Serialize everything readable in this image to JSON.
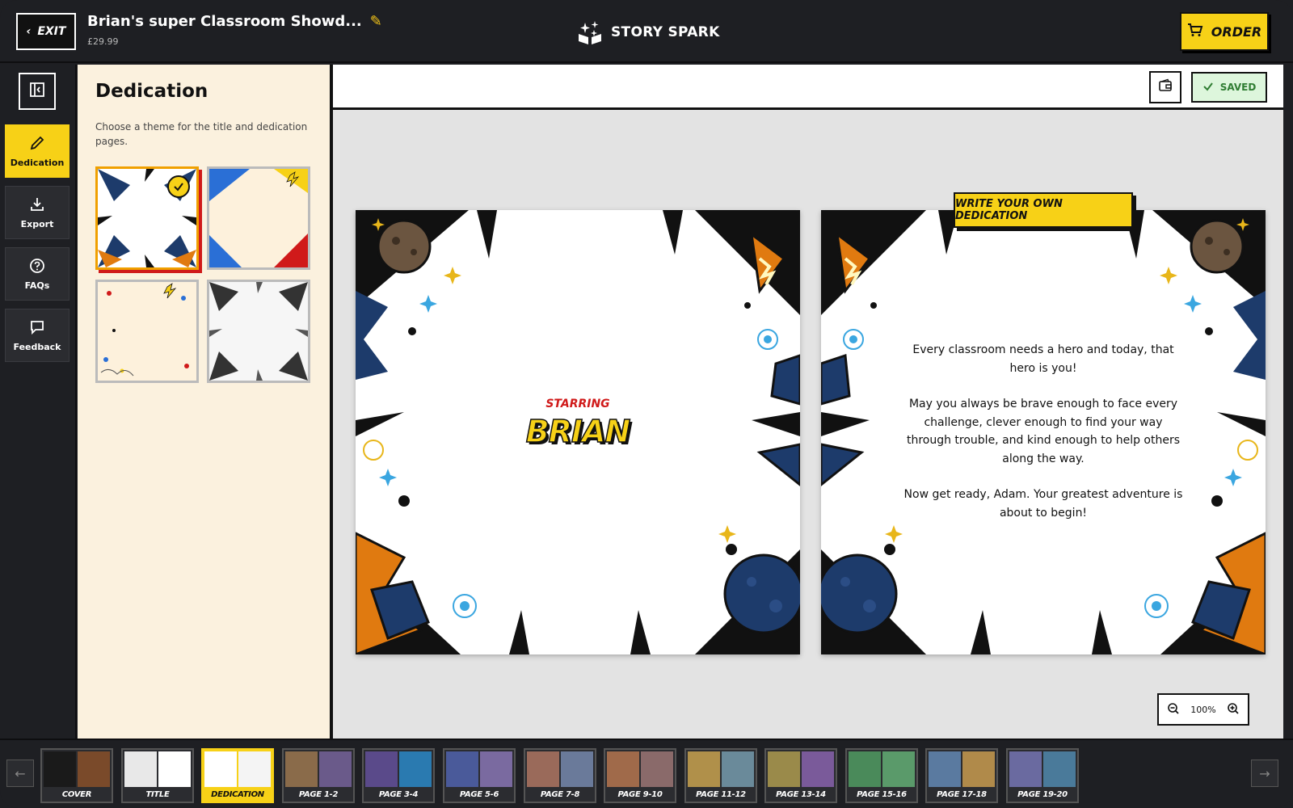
{
  "header": {
    "exit_label": "EXIT",
    "book_title": "Brian's super Classroom Showd...",
    "price": "£29.99",
    "brand": "STORY SPARK",
    "order_label": "ORDER"
  },
  "sidebar": {
    "items": [
      {
        "label": "Dedication",
        "icon": "pencil-icon",
        "active": true
      },
      {
        "label": "Export",
        "icon": "download-icon",
        "active": false
      },
      {
        "label": "FAQs",
        "icon": "help-circle-icon",
        "active": false
      },
      {
        "label": "Feedback",
        "icon": "chat-bubble-icon",
        "active": false
      }
    ]
  },
  "panel": {
    "title": "Dedication",
    "description": "Choose a theme for the title and dedication pages."
  },
  "toolbar": {
    "saved_label": "SAVED"
  },
  "pages": {
    "starring": "STARRING",
    "hero_name": "BRIAN",
    "write_button": "WRITE YOUR OWN DEDICATION",
    "dedication": [
      "Every classroom needs a hero and today, that hero is you!",
      "May you always be brave enough to face every challenge, clever enough to find your way through trouble, and kind enough to help others along the way.",
      "Now get ready, Adam. Your greatest adventure is about to begin!"
    ]
  },
  "zoom": {
    "value": "100%"
  },
  "filmstrip": {
    "thumbs": [
      "COVER",
      "TITLE",
      "DEDICATION",
      "PAGE 1-2",
      "PAGE 3-4",
      "PAGE 5-6",
      "PAGE 7-8",
      "PAGE 9-10",
      "PAGE 11-12",
      "PAGE 13-14",
      "PAGE 15-16",
      "PAGE 17-18",
      "PAGE 19-20"
    ],
    "active": "DEDICATION"
  },
  "colors": {
    "accent_yellow": "#f7d117",
    "dark_bg": "#1e1f23",
    "panel_bg": "#fbf1de",
    "saved_green": "#2f7d32",
    "hero_red": "#d01a1a"
  }
}
